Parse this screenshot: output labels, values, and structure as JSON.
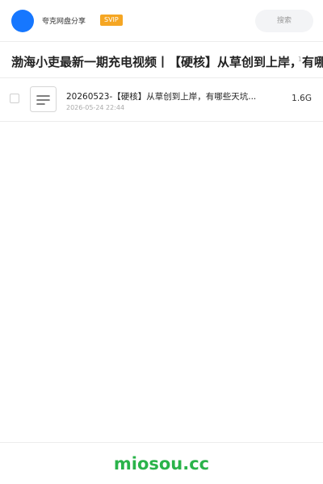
{
  "header": {
    "avatar_color": "#1677ff",
    "username": "夸克网盘分享",
    "badge": "SVIP",
    "search_placeholder": "搜索"
  },
  "share": {
    "title": "渤海小吏最新一期充电视频丨【硬核】从草创到上岸，有哪些天坑",
    "count": "1"
  },
  "files": [
    {
      "icon": "document-icon",
      "name": "20260523-【硬核】从草创到上岸，有哪些天坑...",
      "date": "2026-05-24 22:44",
      "size": "1.6G"
    }
  ],
  "footer": {
    "brand": "miosou.cc",
    "brand_color": "#2ab34a"
  }
}
